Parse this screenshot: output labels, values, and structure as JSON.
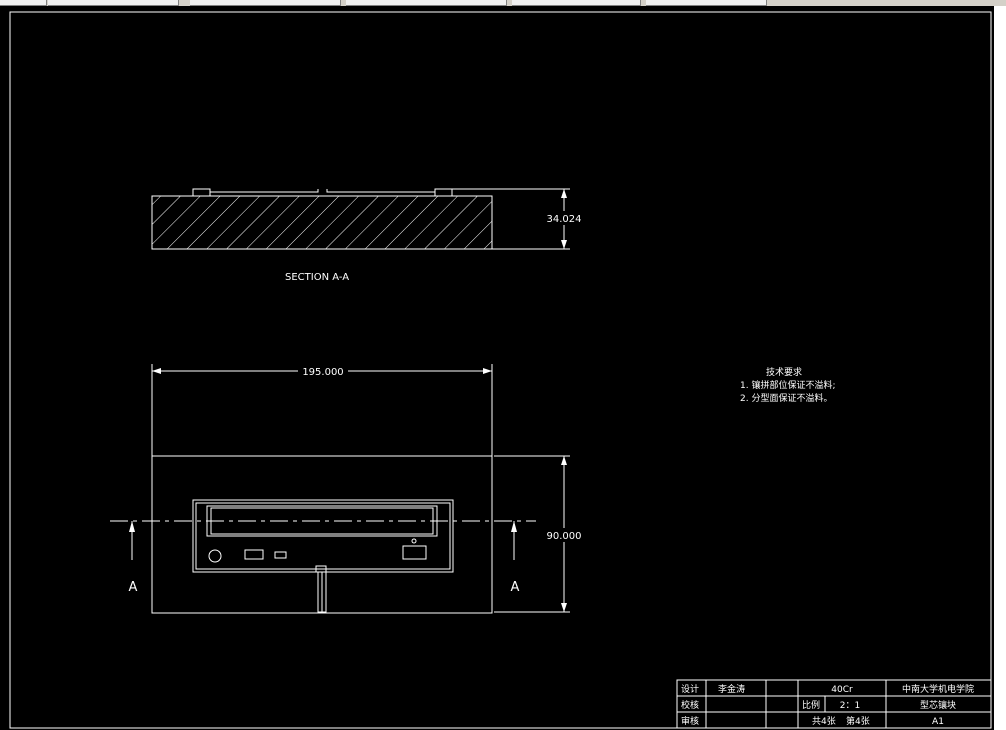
{
  "drawing": {
    "section_label": "SECTION A-A",
    "dim_thickness": "34.024",
    "dim_width": "195.000",
    "dim_height": "90.000",
    "cut_letter_left": "A",
    "cut_letter_right": "A"
  },
  "notes": {
    "title": "技术要求",
    "line1": "1. 镶拼部位保证不溢料;",
    "line2": "2. 分型面保证不溢料。"
  },
  "title_block": {
    "design_label": "设计",
    "designer": "李金涛",
    "check_label": "校核",
    "review_label": "审核",
    "material": "40Cr",
    "school": "中南大学机电学院",
    "scale_label": "比例",
    "scale_value": "2：1",
    "part_name": "型芯镶块",
    "sheet_total": "共4张",
    "sheet_no": "第4张",
    "paper_size": "A1"
  }
}
